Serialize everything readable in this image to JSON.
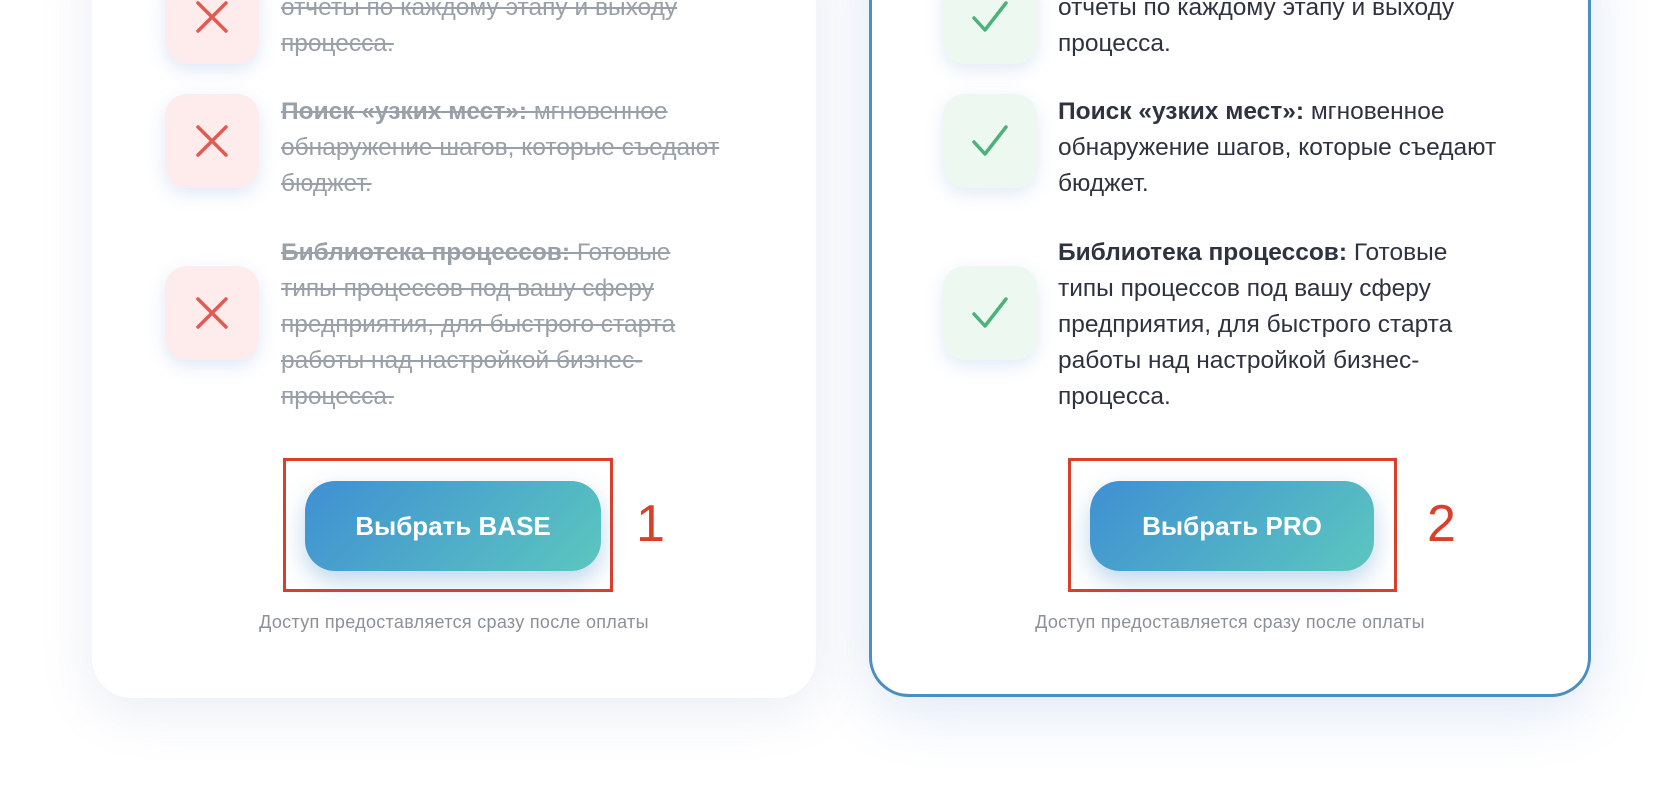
{
  "base": {
    "features": [
      {
        "title": "",
        "desc": "отчеты по каждому этапу и выходу процесса."
      },
      {
        "title": "Поиск «узких мест»:",
        "desc": " мгновенное обнаружение шагов, которые съедают бюджет."
      },
      {
        "title": "Библиотека процессов:",
        "desc": " Готовые типы процессов под вашу сферу предприятия, для быстрого старта работы над настройкой бизнес-процесса."
      }
    ],
    "button_label": "Выбрать BASE",
    "note": "Доступ предоставляется сразу после оплаты",
    "marker": "1"
  },
  "pro": {
    "features": [
      {
        "title": "",
        "desc": "отчеты по каждому этапу и выходу процесса."
      },
      {
        "title": "Поиск «узких мест»:",
        "desc": " мгновенное обнаружение шагов, которые съедают бюджет."
      },
      {
        "title": "Библиотека процессов:",
        "desc": " Готовые типы процессов под вашу сферу предприятия, для быстрого старта работы над настройкой бизнес-процесса."
      }
    ],
    "button_label": "Выбрать PRO",
    "note": "Доступ предоставляется сразу после оплаты",
    "marker": "2"
  },
  "colors": {
    "cross": "#e35a51",
    "check": "#4bb27a",
    "highlight": "#d9402b",
    "pro_border": "#4a8fc2"
  },
  "icons": {
    "excluded": "cross-icon",
    "included": "check-icon"
  }
}
